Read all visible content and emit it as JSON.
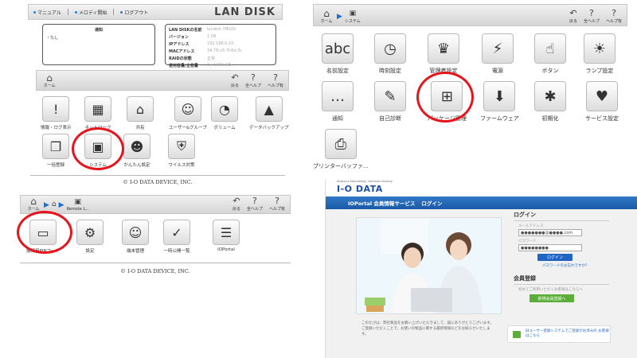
{
  "top_links": {
    "manual": "マニュアル",
    "media": "メロディ開始",
    "logout": "ログアウト",
    "brand": "LAN DISK"
  },
  "info": {
    "notice_header": "通知",
    "notice_item": "・なし",
    "rows": [
      {
        "k": "LAN DISKの名前",
        "v": "landisk-7f6d3c"
      },
      {
        "k": "バージョン",
        "v": "1.08"
      },
      {
        "k": "IPアドレス",
        "v": "192.168.0.10"
      },
      {
        "k": "MACアドレス",
        "v": "34:76:c5:7f:6d:3c"
      },
      {
        "k": "RAIDの状態",
        "v": "正常"
      },
      {
        "k": "使用容量/全容量",
        "v": "1 / 1000 GB"
      }
    ]
  },
  "nav": {
    "home": "ホーム",
    "back": "戻る",
    "all_help": "全ヘルプ",
    "help": "ヘルプ有",
    "system": "システム",
    "remote": "Remote L..."
  },
  "left_tiles": [
    {
      "icon": "!",
      "label": "情報・ログ表示"
    },
    {
      "icon": "▦",
      "label": "ネットワーク"
    },
    {
      "icon": "⌂",
      "label": "共有"
    },
    {
      "icon": "☺",
      "label": "ユーザー&グループ"
    },
    {
      "icon": "◔",
      "label": "ボリューム"
    },
    {
      "icon": "▲",
      "label": "データバックアップ"
    },
    {
      "icon": "❐",
      "label": "一括登録"
    },
    {
      "icon": "▣",
      "label": "システム"
    },
    {
      "icon": "☻",
      "label": "かんたん設定"
    },
    {
      "icon": "⛨",
      "label": "ウイルス対策"
    }
  ],
  "bottom_tiles": [
    {
      "icon": "▭",
      "label": "接続用PINコード"
    },
    {
      "icon": "⚙",
      "label": "設定"
    },
    {
      "icon": "☺",
      "label": "端末管理"
    },
    {
      "icon": "✓",
      "label": "一時公開一覧"
    },
    {
      "icon": "☰",
      "label": "IOPortal"
    }
  ],
  "right_tiles": [
    {
      "icon": "abc",
      "label": "名前設定"
    },
    {
      "icon": "◷",
      "label": "時刻設定"
    },
    {
      "icon": "♛",
      "label": "管理者設定"
    },
    {
      "icon": "⚡",
      "label": "電源"
    },
    {
      "icon": "☝",
      "label": "ボタン"
    },
    {
      "icon": "☀",
      "label": "ランプ設定"
    },
    {
      "icon": "…",
      "label": "通知"
    },
    {
      "icon": "✎",
      "label": "自己診断"
    },
    {
      "icon": "⊞",
      "label": "パッケージ管理"
    },
    {
      "icon": "⬇",
      "label": "ファームウェア"
    },
    {
      "icon": "✱",
      "label": "初期化"
    },
    {
      "icon": "♥",
      "label": "サービス設定"
    },
    {
      "icon": "⎙",
      "label": "プリンターバッファ..."
    }
  ],
  "copyright": "© I-O DATA DEVICE, INC.",
  "portal": {
    "logo": "I-O DATA",
    "tagline": "Always a Fascinating, Continue thinking",
    "bar_title": "IOPortal 会員情報サービス",
    "bar_login": "ログイン",
    "login_title": "ログイン",
    "email_label": "メールアドレス",
    "email_value": "●●●●●●●@●●●●.com",
    "pw_label": "パスワード",
    "pw_value": "●●●●●●●●",
    "login_btn": "ログイン",
    "forgot": "パスワードをお忘れですか？",
    "register_title": "会員登録",
    "register_desc": "初めてご利用いただくお客様はこちらへ",
    "register_btn": "新規会員登録へ",
    "body_text": "このたびは、弊社製品をお買い上げいただきまして、誠にありがとうございます。ご登録いただくことで、お使いの製品に関する最新情報などをお知らせいたします。",
    "info_text": "旧ユーザー登録システムでご登録がお済みの お客様はこちら"
  }
}
